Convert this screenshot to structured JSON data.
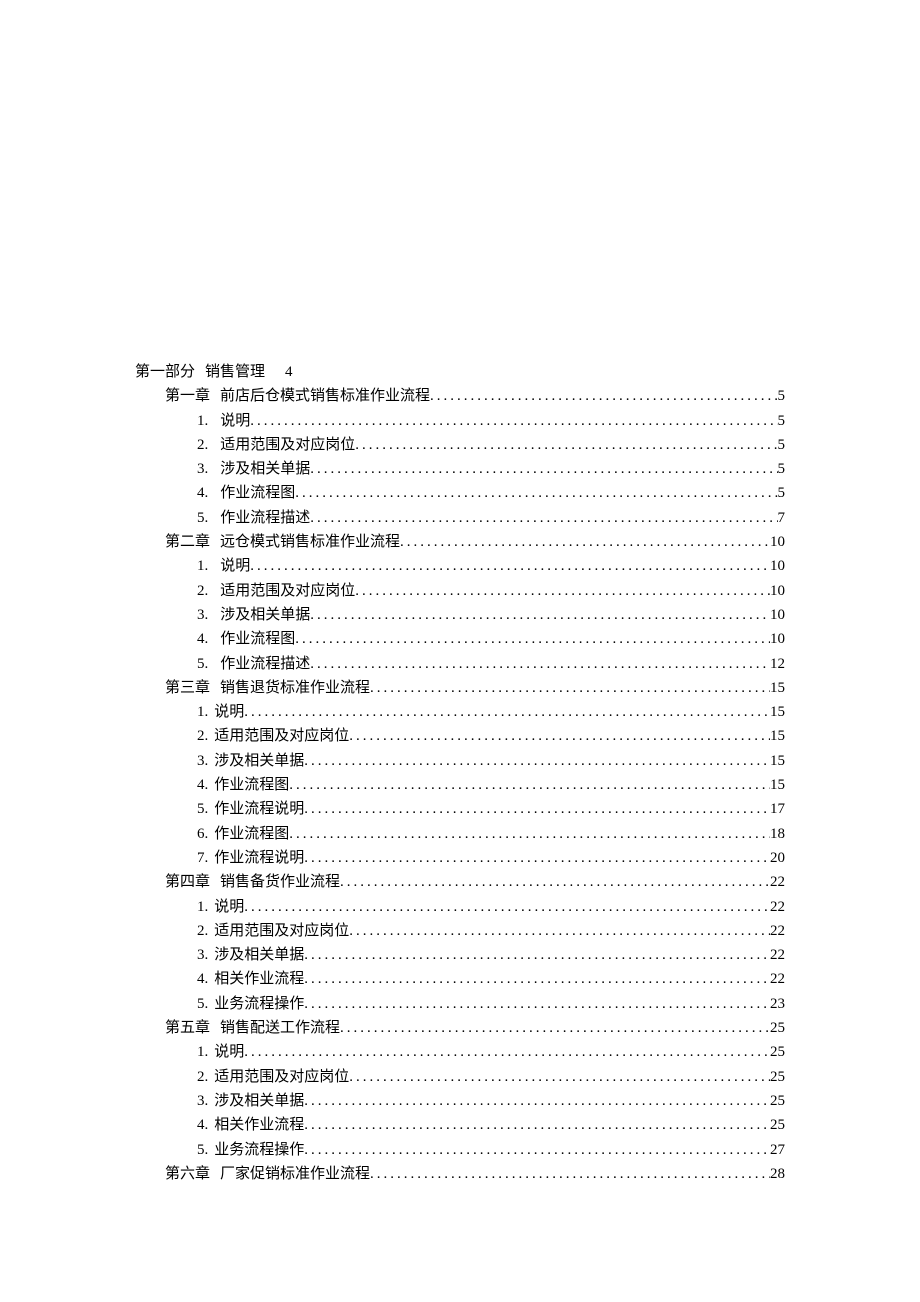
{
  "part": {
    "label": "第一部分",
    "title": "销售管理",
    "page": "4"
  },
  "entries": [
    {
      "level": 1,
      "num": "第一章",
      "title": "前店后仓模式销售标准作业流程",
      "page": "5",
      "style": "space"
    },
    {
      "level": 2,
      "num": "1.",
      "title": "说明",
      "page": "5",
      "style": "dot"
    },
    {
      "level": 2,
      "num": "2.",
      "title": "适用范围及对应岗位",
      "page": "5",
      "style": "dot"
    },
    {
      "level": 2,
      "num": "3.",
      "title": "涉及相关单据",
      "page": "5",
      "style": "dot"
    },
    {
      "level": 2,
      "num": "4.",
      "title": "作业流程图",
      "page": "5",
      "style": "dot"
    },
    {
      "level": 2,
      "num": "5.",
      "title": "作业流程描述",
      "page": "7",
      "style": "dot"
    },
    {
      "level": 1,
      "num": "第二章",
      "title": "远仓模式销售标准作业流程",
      "page": "10",
      "style": "space"
    },
    {
      "level": 2,
      "num": "1.",
      "title": "说明",
      "page": "10",
      "style": "dot"
    },
    {
      "level": 2,
      "num": "2.",
      "title": "适用范围及对应岗位",
      "page": "10",
      "style": "dot"
    },
    {
      "level": 2,
      "num": "3.",
      "title": "涉及相关单据",
      "page": "10",
      "style": "dot"
    },
    {
      "level": 2,
      "num": "4.",
      "title": "作业流程图",
      "page": "10",
      "style": "dot"
    },
    {
      "level": 2,
      "num": "5.",
      "title": "作业流程描述",
      "page": "12",
      "style": "dot"
    },
    {
      "level": 1,
      "num": "第三章",
      "title": "销售退货标准作业流程",
      "page": "15",
      "style": "space"
    },
    {
      "level": 2,
      "num": "1.",
      "title": "说明",
      "page": "15",
      "style": "tight"
    },
    {
      "level": 2,
      "num": "2.",
      "title": "适用范围及对应岗位",
      "page": "15",
      "style": "tight"
    },
    {
      "level": 2,
      "num": "3.",
      "title": "涉及相关单据",
      "page": "15",
      "style": "tight"
    },
    {
      "level": 2,
      "num": "4.",
      "title": "作业流程图",
      "page": "15",
      "style": "tight"
    },
    {
      "level": 2,
      "num": "5.",
      "title": "作业流程说明",
      "page": "17",
      "style": "tight"
    },
    {
      "level": 2,
      "num": "6.",
      "title": "作业流程图",
      "page": "18",
      "style": "tight"
    },
    {
      "level": 2,
      "num": "7.",
      "title": "作业流程说明",
      "page": "20",
      "style": "tight"
    },
    {
      "level": 1,
      "num": "第四章",
      "title": "销售备货作业流程",
      "page": "22",
      "style": "space"
    },
    {
      "level": 2,
      "num": "1.",
      "title": "说明",
      "page": "22",
      "style": "tight"
    },
    {
      "level": 2,
      "num": "2.",
      "title": "适用范围及对应岗位",
      "page": "22",
      "style": "tight"
    },
    {
      "level": 2,
      "num": "3.",
      "title": "涉及相关单据",
      "page": "22",
      "style": "tight"
    },
    {
      "level": 2,
      "num": "4.",
      "title": "相关作业流程",
      "page": "22",
      "style": "tight"
    },
    {
      "level": 2,
      "num": "5.",
      "title": "业务流程操作",
      "page": "23",
      "style": "tight"
    },
    {
      "level": 1,
      "num": "第五章",
      "title": "销售配送工作流程",
      "page": "25",
      "style": "space"
    },
    {
      "level": 2,
      "num": "1.",
      "title": "说明",
      "page": "25",
      "style": "tight"
    },
    {
      "level": 2,
      "num": "2.",
      "title": "适用范围及对应岗位",
      "page": "25",
      "style": "tight"
    },
    {
      "level": 2,
      "num": "3.",
      "title": "涉及相关单据",
      "page": "25",
      "style": "tight"
    },
    {
      "level": 2,
      "num": "4.",
      "title": "相关作业流程",
      "page": "25",
      "style": "tight"
    },
    {
      "level": 2,
      "num": "5.",
      "title": "业务流程操作",
      "page": "27",
      "style": "tight"
    },
    {
      "level": 1,
      "num": "第六章",
      "title": "厂家促销标准作业流程",
      "page": "28",
      "style": "space"
    }
  ]
}
